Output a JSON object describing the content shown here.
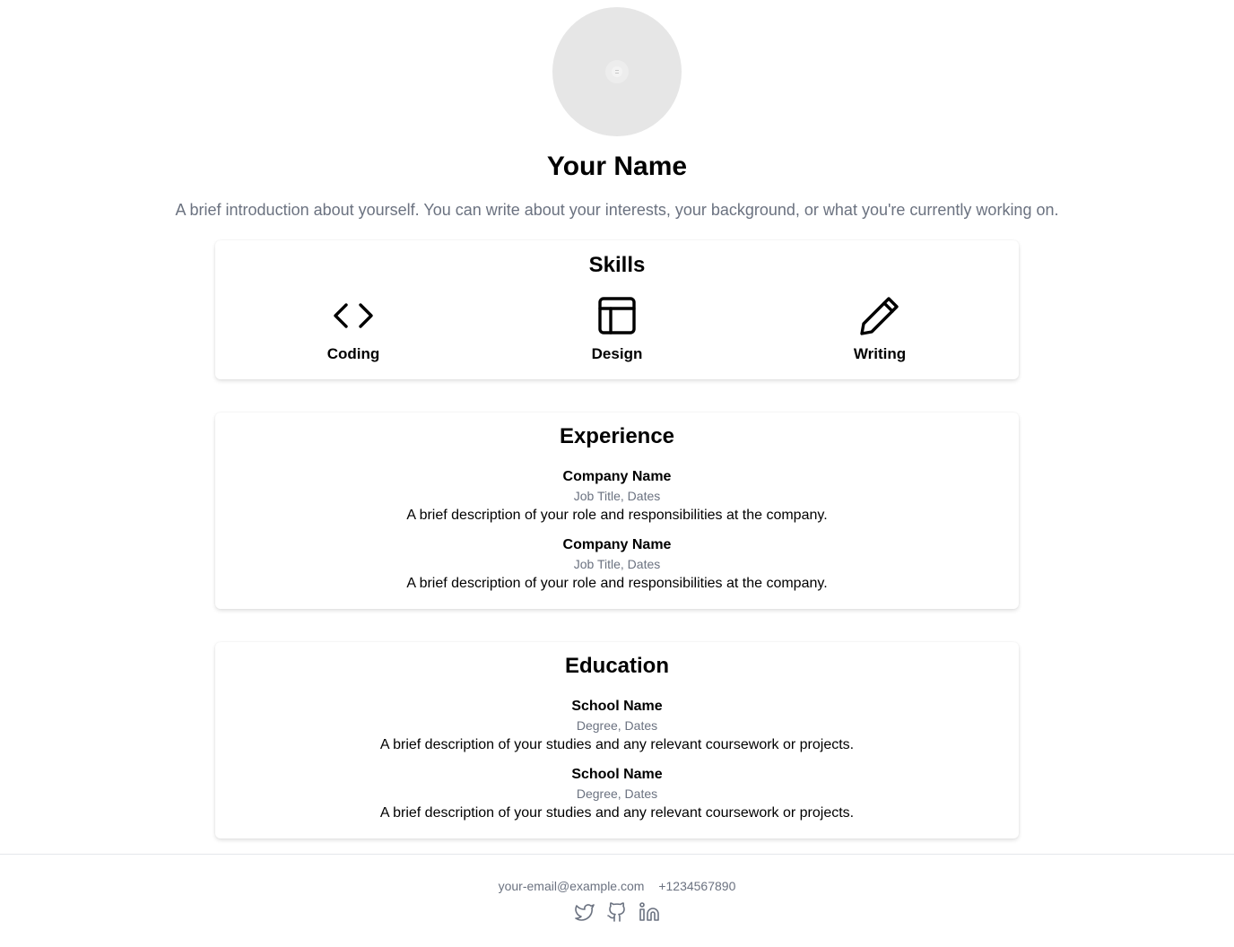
{
  "profile": {
    "avatar_alt": "",
    "name": "Your Name",
    "intro": "A brief introduction about yourself. You can write about your interests, your background, or what you're currently working on."
  },
  "skills": {
    "title": "Skills",
    "items": [
      {
        "label": "Coding",
        "icon": "code-brackets-icon"
      },
      {
        "label": "Design",
        "icon": "layout-icon"
      },
      {
        "label": "Writing",
        "icon": "pencil-icon"
      }
    ]
  },
  "experience": {
    "title": "Experience",
    "items": [
      {
        "name": "Company Name",
        "sub": "Job Title, Dates",
        "desc": "A brief description of your role and responsibilities at the company."
      },
      {
        "name": "Company Name",
        "sub": "Job Title, Dates",
        "desc": "A brief description of your role and responsibilities at the company."
      }
    ]
  },
  "education": {
    "title": "Education",
    "items": [
      {
        "name": "School Name",
        "sub": "Degree, Dates",
        "desc": "A brief description of your studies and any relevant coursework or projects."
      },
      {
        "name": "School Name",
        "sub": "Degree, Dates",
        "desc": "A brief description of your studies and any relevant coursework or projects."
      }
    ]
  },
  "footer": {
    "email": "your-email@example.com",
    "phone": "+1234567890",
    "socials": [
      "twitter-icon",
      "github-icon",
      "linkedin-icon"
    ]
  },
  "colors": {
    "text": "#000000",
    "muted": "#6b7280",
    "avatar_bg": "#e6e6e6",
    "border": "#e5e7eb"
  }
}
